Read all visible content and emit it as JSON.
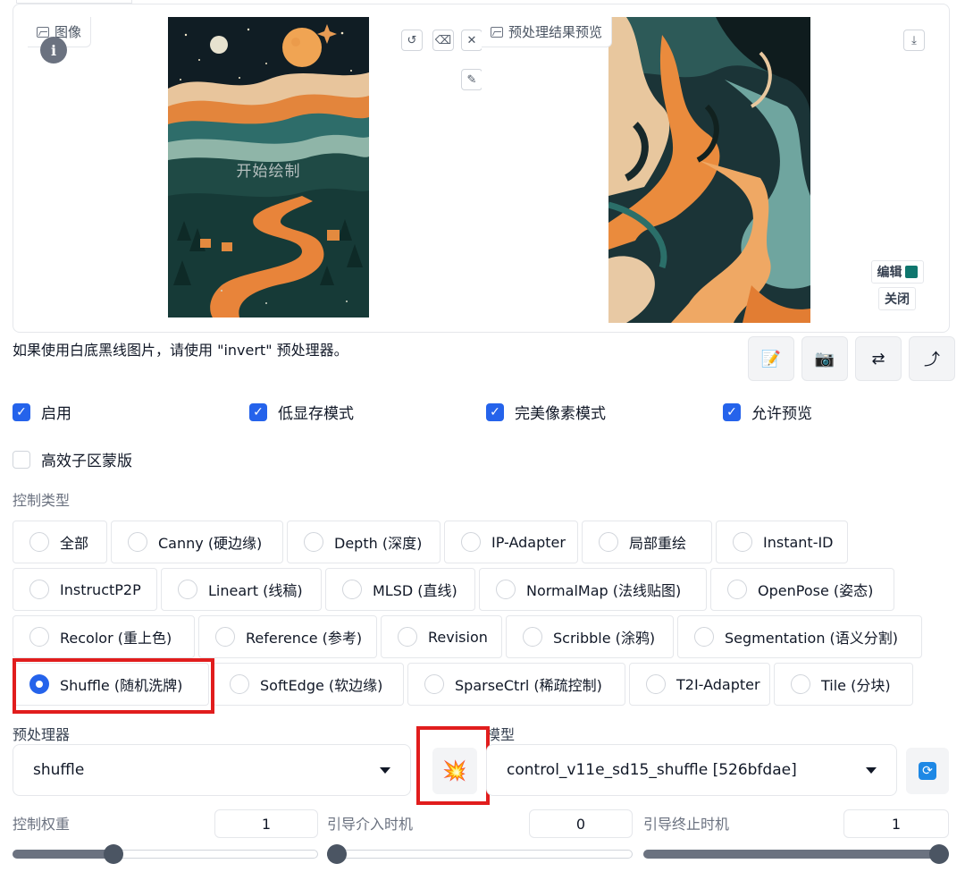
{
  "image_panel": {
    "input_label": "图像",
    "input_canvas_overlay": "开始绘制",
    "preview_label": "预处理结果预览",
    "edit_label": "编辑",
    "close_label": "关闭"
  },
  "hint_text": "如果使用白底黑线图片，请使用 \"invert\" 预处理器。",
  "checkboxes": [
    {
      "label": "启用",
      "checked": true
    },
    {
      "label": "低显存模式",
      "checked": true
    },
    {
      "label": "完美像素模式",
      "checked": true
    },
    {
      "label": "允许预览",
      "checked": true
    },
    {
      "label": "高效子区蒙版",
      "checked": false
    }
  ],
  "control_type": {
    "label": "控制类型",
    "options": [
      "全部",
      "Canny (硬边缘)",
      "Depth (深度)",
      "IP-Adapter",
      "局部重绘",
      "Instant-ID",
      "InstructP2P",
      "Lineart (线稿)",
      "MLSD (直线)",
      "NormalMap (法线贴图)",
      "OpenPose (姿态)",
      "Recolor (重上色)",
      "Reference (参考)",
      "Revision",
      "Scribble (涂鸦)",
      "Segmentation (语义分割)",
      "Shuffle (随机洗牌)",
      "SoftEdge (软边缘)",
      "SparseCtrl (稀疏控制)",
      "T2I-Adapter",
      "Tile (分块)"
    ],
    "selected": "Shuffle (随机洗牌)"
  },
  "preprocessor": {
    "label": "预处理器",
    "value": "shuffle"
  },
  "model": {
    "label": "模型",
    "value": "control_v11e_sd15_shuffle [526bfdae]"
  },
  "control_weight": {
    "label": "控制权重",
    "value": "1",
    "fraction": 0.32
  },
  "start_step": {
    "label": "引导介入时机",
    "value": "0",
    "fraction": 0.0
  },
  "end_step": {
    "label": "引导终止时机",
    "value": "1",
    "fraction": 1.0
  },
  "colors": {
    "accent": "#2563eb",
    "highlight": "#e11d1d"
  }
}
